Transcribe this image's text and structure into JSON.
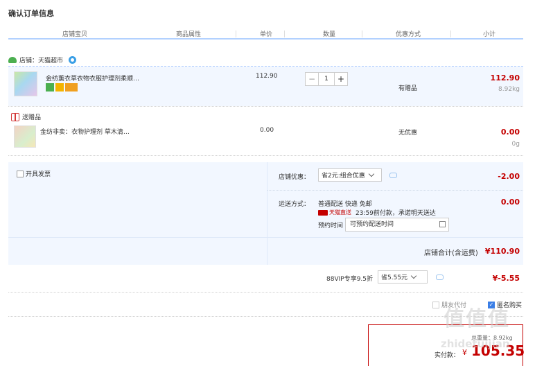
{
  "page": {
    "title": "确认订单信息"
  },
  "columns": [
    "店铺宝贝",
    "商品属性",
    "单价",
    "数量",
    "优惠方式",
    "小计"
  ],
  "shop": {
    "label": "店铺：天猫超市"
  },
  "item": {
    "name": "金纺薰衣草衣物衣服护理剂柔顺…",
    "unit_price": "112.90",
    "quantity": "1",
    "promo": "有赠品",
    "subtotal": "112.90",
    "weight": "8.92kg"
  },
  "gift": {
    "section_title": "送赠品",
    "name": "金纺非卖：衣物护理剂 草木清…",
    "unit_price": "0.00",
    "promo": "无优惠",
    "subtotal": "0.00",
    "weight": "0g"
  },
  "invoice": {
    "label": "开具发票"
  },
  "shop_discount": {
    "label": "店铺优惠：",
    "selected": "省2元:组合优惠",
    "amount": "-2.00"
  },
  "shipping": {
    "label": "运送方式：",
    "method": "普通配送 快递 免邮",
    "badge_text": "天猫直送",
    "promise": "23:59前付款，承诺明天送达",
    "time_label": "预约时间",
    "time_placeholder": "可预约配送时间",
    "amount": "0.00"
  },
  "shop_total": {
    "label": "店铺合计(含运费)",
    "amount": "¥110.90"
  },
  "vip": {
    "label": "88VIP专享9.5折",
    "selected": "省5.55元",
    "amount": "¥-5.55"
  },
  "options": {
    "friend_pay": "朋友代付",
    "anonymous": "匿名购买"
  },
  "final": {
    "weight_label": "总重量：8.92kg",
    "pay_label": "实付款：",
    "currency": "¥",
    "amount": "105.35"
  },
  "watermark": {
    "logo": "值值值",
    "site": "zhidetuijian"
  },
  "colors": {
    "accent": "#c40000",
    "panel_bg": "#f2f7ff",
    "header_line": "#b2d1ff"
  }
}
